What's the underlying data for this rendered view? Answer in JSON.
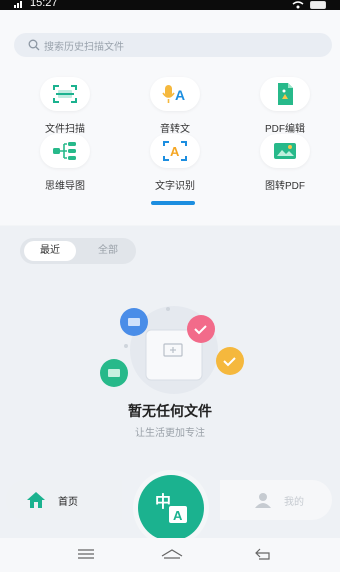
{
  "status_bar": {
    "time": "15:27"
  },
  "search": {
    "placeholder": "搜索历史扫描文件"
  },
  "tools": [
    {
      "label": "文件扫描",
      "icon": "scan-frame-icon"
    },
    {
      "label": "音转文",
      "icon": "microphone-a-icon"
    },
    {
      "label": "PDF编辑",
      "icon": "pdf-document-icon"
    },
    {
      "label": "思维导图",
      "icon": "mind-map-icon"
    },
    {
      "label": "文字识别",
      "icon": "text-recognition-icon"
    },
    {
      "label": "图转PDF",
      "icon": "image-to-pdf-icon"
    }
  ],
  "tabs": {
    "recent": "最近",
    "all": "全部"
  },
  "empty": {
    "title": "暂无任何文件",
    "subtitle": "让生活更加专注"
  },
  "bottom_nav": {
    "home": "首页",
    "mine": "我的"
  },
  "fab": {
    "glyph_top": "中",
    "glyph_bottom": "A"
  },
  "colors": {
    "accent_green": "#1bb28f",
    "accent_blue": "#1c8ee0"
  }
}
